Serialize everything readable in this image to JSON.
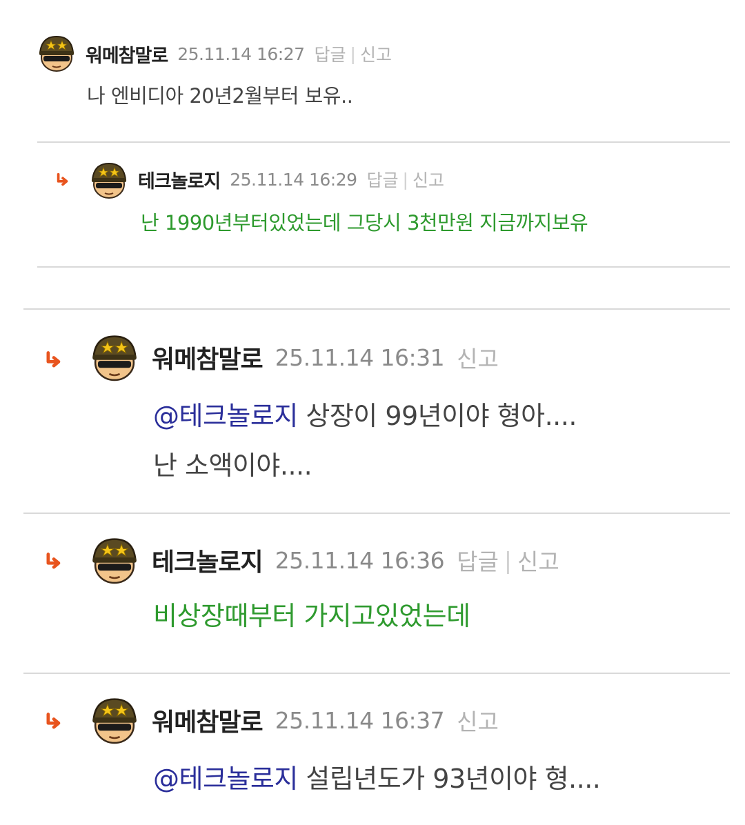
{
  "comments": [
    {
      "author": "워메참말로",
      "date": "25.11.14 16:27",
      "reply_label": "답글",
      "separator": "|",
      "report_label": "신고",
      "body": "나 엔비디아 20년2월부터 보유.."
    },
    {
      "author": "테크놀로지",
      "date": "25.11.14 16:29",
      "reply_label": "답글",
      "separator": "|",
      "report_label": "신고",
      "body": "난 1990년부터있었는데 그당시 3천만원 지금까지보유"
    },
    {
      "author": "워메참말로",
      "date": "25.11.14 16:31",
      "report_label": "신고",
      "mention": "@테크놀로지",
      "body_line1": " 상장이 99년이야 형아....",
      "body_line2": "난 소액이야...."
    },
    {
      "author": "테크놀로지",
      "date": "25.11.14 16:36",
      "reply_label": "답글",
      "separator": "|",
      "report_label": "신고",
      "body": "비상장때부터 가지고있었는데"
    },
    {
      "author": "워메참말로",
      "date": "25.11.14 16:37",
      "report_label": "신고",
      "mention": "@테크놀로지",
      "body": " 설립년도가 93년이야 형...."
    }
  ],
  "icons": {
    "avatar": "soldier-avatar-icon",
    "reply_arrow": "reply-arrow-icon"
  },
  "colors": {
    "reply_arrow": "#e8541e",
    "green_text": "#2e9a2e",
    "mention": "#2a2e9a",
    "divider": "#d9d9d9"
  }
}
